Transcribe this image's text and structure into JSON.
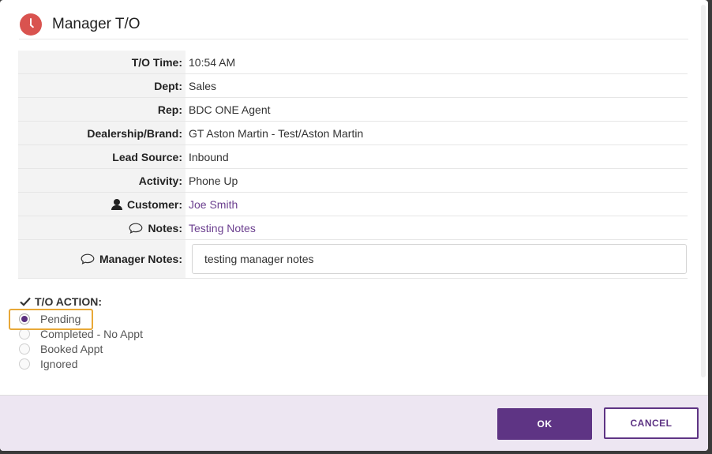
{
  "dialog": {
    "title": "Manager T/O",
    "icon": "clock-icon",
    "accent_color": "#5e3484",
    "icon_color": "#d9534f"
  },
  "details": {
    "to_time": {
      "label": "T/O Time:",
      "value": "10:54 AM"
    },
    "dept": {
      "label": "Dept:",
      "value": "Sales"
    },
    "rep": {
      "label": "Rep:",
      "value": "BDC ONE Agent"
    },
    "dealership": {
      "label": "Dealership/Brand:",
      "value": "GT Aston Martin - Test/Aston Martin"
    },
    "lead_source": {
      "label": "Lead Source:",
      "value": "Inbound"
    },
    "activity": {
      "label": "Activity:",
      "value": "Phone Up"
    },
    "customer": {
      "label": "Customer:",
      "value": "Joe Smith",
      "icon": "person-icon"
    },
    "notes": {
      "label": "Notes:",
      "value": "Testing Notes",
      "icon": "comment-icon"
    },
    "manager_notes": {
      "label": "Manager Notes:",
      "value": "testing manager notes",
      "icon": "comment-icon"
    }
  },
  "to_action": {
    "title": "T/O ACTION:",
    "icon": "check-icon",
    "selected": "Pending",
    "options": [
      "Pending",
      "Completed - No Appt",
      "Booked Appt",
      "Ignored"
    ]
  },
  "footer": {
    "ok_label": "OK",
    "cancel_label": "CANCEL"
  }
}
